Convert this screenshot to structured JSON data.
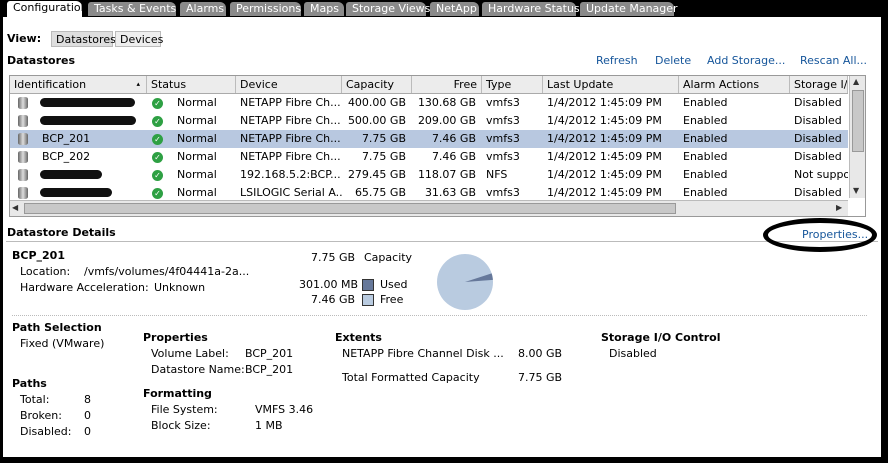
{
  "tabs": [
    {
      "label": "Configuration",
      "active": true
    },
    {
      "label": "Tasks & Events"
    },
    {
      "label": "Alarms"
    },
    {
      "label": "Permissions"
    },
    {
      "label": "Maps"
    },
    {
      "label": "Storage Views"
    },
    {
      "label": "NetApp"
    },
    {
      "label": "Hardware Status"
    },
    {
      "label": "Update Manager"
    }
  ],
  "view": {
    "label": "View:",
    "datastores": "Datastores",
    "devices": "Devices"
  },
  "datastores": {
    "title": "Datastores",
    "actions": {
      "refresh": "Refresh",
      "delete": "Delete",
      "add_storage": "Add Storage...",
      "rescan": "Rescan All..."
    },
    "columns": [
      "Identification",
      "Status",
      "Device",
      "Capacity",
      "Free",
      "Type",
      "Last Update",
      "Alarm Actions",
      "Storage I/O"
    ],
    "rows": [
      {
        "id": "",
        "status": "Normal",
        "device": "NETAPP Fibre Ch...",
        "capacity": "400.00 GB",
        "free": "130.68 GB",
        "type": "vmfs3",
        "last_update": "1/4/2012 1:45:09 PM",
        "alarm": "Enabled",
        "sio": "Disabled"
      },
      {
        "id": "",
        "status": "Normal",
        "device": "NETAPP Fibre Ch...",
        "capacity": "500.00 GB",
        "free": "209.00 GB",
        "type": "vmfs3",
        "last_update": "1/4/2012 1:45:09 PM",
        "alarm": "Enabled",
        "sio": "Disabled"
      },
      {
        "id": "BCP_201",
        "status": "Normal",
        "device": "NETAPP Fibre Ch...",
        "capacity": "7.75 GB",
        "free": "7.46 GB",
        "type": "vmfs3",
        "last_update": "1/4/2012 1:45:09 PM",
        "alarm": "Enabled",
        "sio": "Disabled"
      },
      {
        "id": "BCP_202",
        "status": "Normal",
        "device": "NETAPP Fibre Ch...",
        "capacity": "7.75 GB",
        "free": "7.46 GB",
        "type": "vmfs3",
        "last_update": "1/4/2012 1:45:09 PM",
        "alarm": "Enabled",
        "sio": "Disabled"
      },
      {
        "id": "",
        "status": "Normal",
        "device": "192.168.5.2:BCP...",
        "capacity": "279.45 GB",
        "free": "118.07 GB",
        "type": "NFS",
        "last_update": "1/4/2012 1:45:09 PM",
        "alarm": "Enabled",
        "sio": "Not support"
      },
      {
        "id": "",
        "status": "Normal",
        "device": "LSILOGIC Serial A...",
        "capacity": "65.75 GB",
        "free": "31.63 GB",
        "type": "vmfs3",
        "last_update": "1/4/2012 1:45:09 PM",
        "alarm": "Enabled",
        "sio": "Disabled"
      }
    ],
    "selected_row": 2
  },
  "details": {
    "title": "Datastore Details",
    "properties_link": "Properties...",
    "name": "BCP_201",
    "capacity_value": "7.75 GB",
    "capacity_label": "Capacity",
    "location_label": "Location:",
    "location_value": "/vmfs/volumes/4f04441a-2a...",
    "hw_accel_label": "Hardware Acceleration:",
    "hw_accel_value": "Unknown",
    "used_value": "301.00 MB",
    "used_label": "Used",
    "free_value": "7.46 GB",
    "free_label": "Free",
    "used_fraction": 0.038,
    "path_selection": {
      "title": "Path Selection",
      "value": "Fixed (VMware)"
    },
    "paths": {
      "title": "Paths",
      "total_label": "Total:",
      "total": "8",
      "broken_label": "Broken:",
      "broken": "0",
      "disabled_label": "Disabled:",
      "disabled": "0"
    },
    "properties": {
      "title": "Properties",
      "volume_label_label": "Volume Label:",
      "volume_label": "BCP_201",
      "datastore_name_label": "Datastore Name:",
      "datastore_name": "BCP_201"
    },
    "formatting": {
      "title": "Formatting",
      "fs_label": "File System:",
      "fs": "VMFS 3.46",
      "block_label": "Block Size:",
      "block": "1 MB"
    },
    "extents": {
      "title": "Extents",
      "disk": "NETAPP Fibre Channel Disk ...",
      "disk_size": "8.00 GB",
      "total_label": "Total Formatted Capacity",
      "total": "7.75 GB"
    },
    "sioc": {
      "title": "Storage I/O Control",
      "value": "Disabled"
    }
  },
  "colors": {
    "used": "#66789a",
    "free": "#b9cbe0",
    "selected_row": "#b8c8e0",
    "link": "#15559a"
  }
}
